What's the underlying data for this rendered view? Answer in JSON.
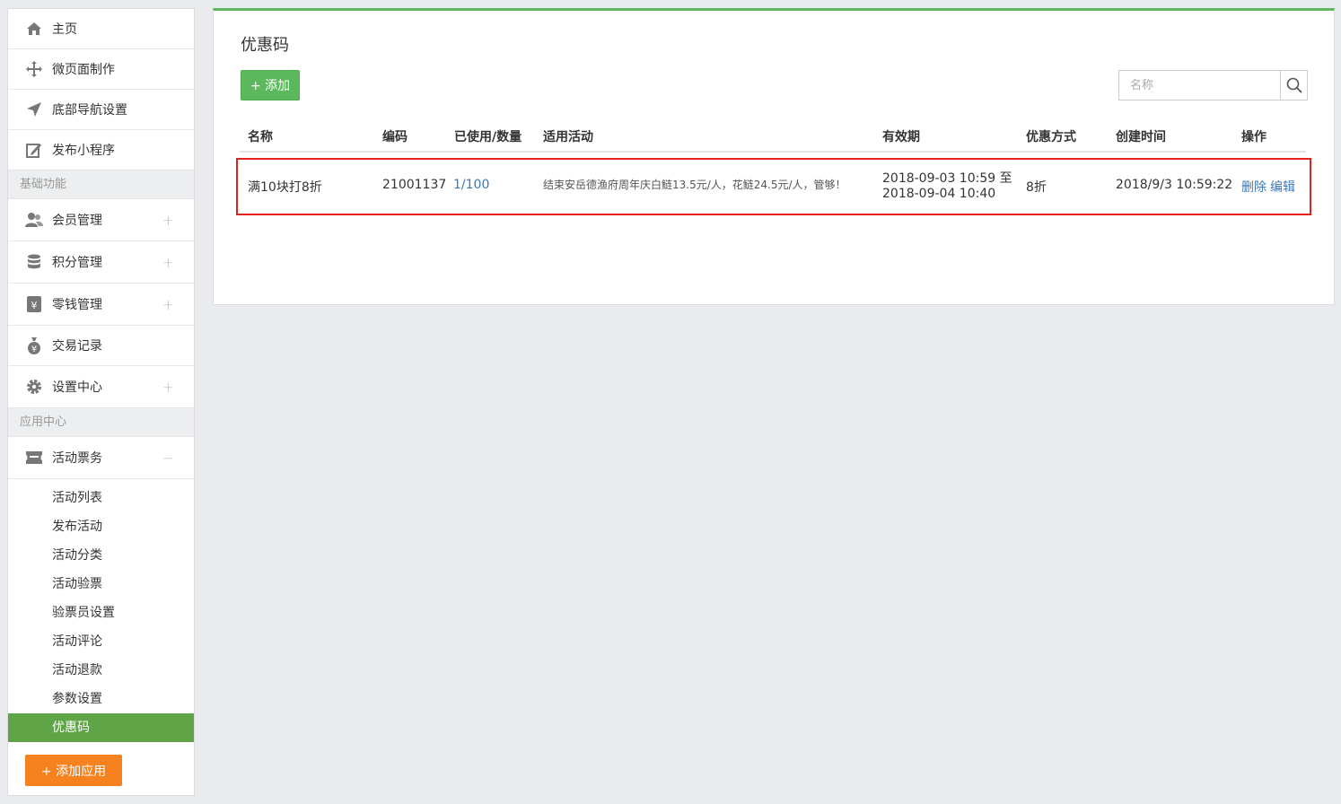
{
  "sidebar": {
    "top_items": [
      {
        "label": "主页",
        "icon": "home-icon"
      },
      {
        "label": "微页面制作",
        "icon": "move-icon"
      },
      {
        "label": "底部导航设置",
        "icon": "navigation-arrow-icon"
      },
      {
        "label": "发布小程序",
        "icon": "edit-icon"
      }
    ],
    "section_basic": "基础功能",
    "basic_items": [
      {
        "label": "会员管理",
        "icon": "users-icon",
        "expand": "+"
      },
      {
        "label": "积分管理",
        "icon": "database-icon",
        "expand": "+"
      },
      {
        "label": "零钱管理",
        "icon": "wallet-icon",
        "expand": "+"
      },
      {
        "label": "交易记录",
        "icon": "money-bag-icon"
      },
      {
        "label": "设置中心",
        "icon": "gear-icon",
        "expand": "+"
      }
    ],
    "section_apps": "应用中心",
    "app_group": {
      "label": "活动票务",
      "icon": "ticket-icon",
      "collapse": "−"
    },
    "sub_items": [
      "活动列表",
      "发布活动",
      "活动分类",
      "活动验票",
      "验票员设置",
      "活动评论",
      "活动退款",
      "参数设置",
      "优惠码"
    ],
    "active_sub": "优惠码",
    "add_app_label": "+ 添加应用"
  },
  "main": {
    "title": "优惠码",
    "add_label": "+ 添加",
    "search_placeholder": "名称",
    "columns": [
      "名称",
      "编码",
      "已使用/数量",
      "适用活动",
      "有效期",
      "优惠方式",
      "创建时间",
      "操作"
    ],
    "rows": [
      {
        "name": "满10块打8折",
        "code": "21001137",
        "usage": "1/100",
        "activity": "结束安岳德渔府周年庆白鲢13.5元/人，花鲢24.5元/人，管够！",
        "valid_from": "2018-09-03 10:59 至",
        "valid_to": "2018-09-04 10:40",
        "discount": "8折",
        "created": "2018/9/3 10:59:22",
        "delete_label": "删除",
        "edit_label": "编辑"
      }
    ]
  },
  "colors": {
    "accent_green": "#5cb85c",
    "active_green": "#5fa548",
    "orange": "#f5821f",
    "link_blue": "#3c78b5",
    "highlight_red": "#e4231f"
  }
}
